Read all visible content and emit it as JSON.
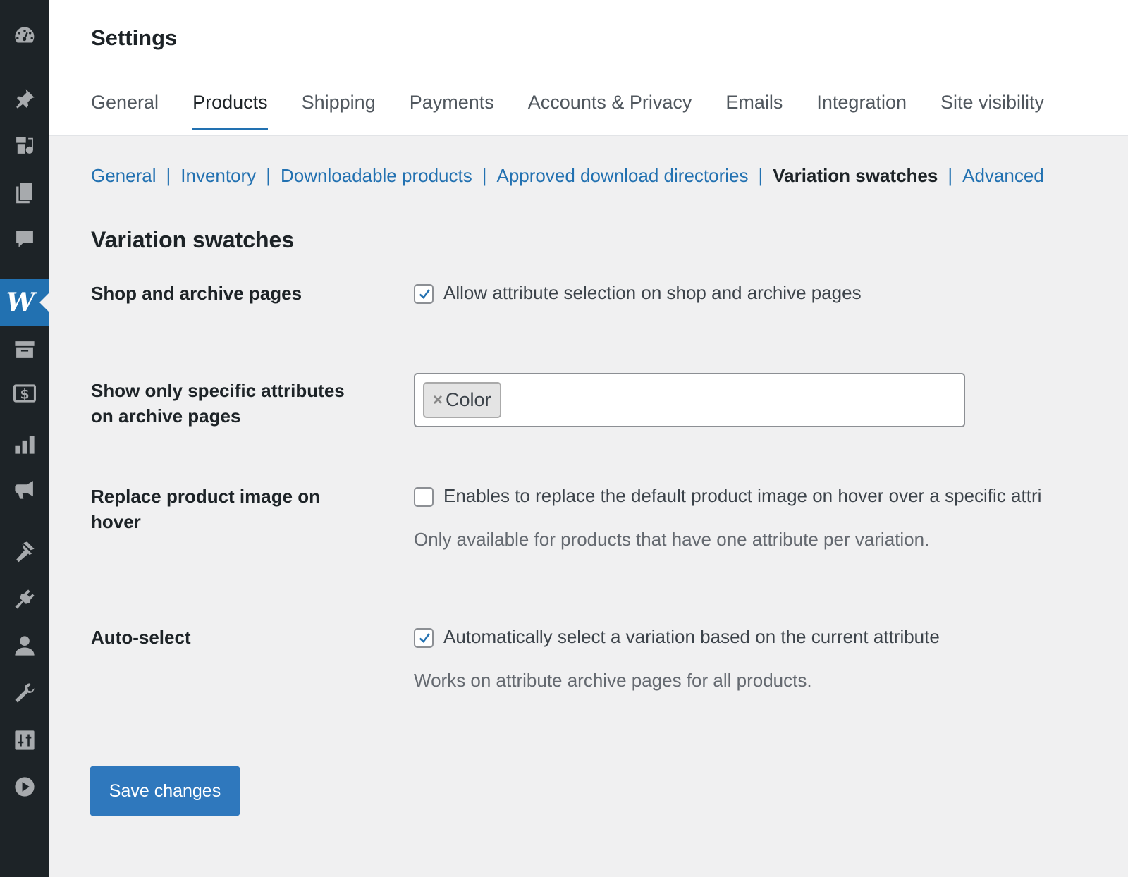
{
  "sidebar": {
    "items": [
      {
        "icon": "dashboard-icon"
      },
      {
        "icon": "pin-icon"
      },
      {
        "icon": "media-icon"
      },
      {
        "icon": "pages-icon"
      },
      {
        "icon": "comments-icon"
      },
      {
        "icon": "woocommerce-icon",
        "label": "W",
        "active": true
      },
      {
        "icon": "archive-icon"
      },
      {
        "icon": "payments-icon"
      },
      {
        "icon": "analytics-icon"
      },
      {
        "icon": "marketing-icon"
      },
      {
        "icon": "appearance-icon"
      },
      {
        "icon": "plugins-icon"
      },
      {
        "icon": "users-icon"
      },
      {
        "icon": "tools-icon"
      },
      {
        "icon": "settings-sliders-icon"
      },
      {
        "icon": "play-icon"
      }
    ]
  },
  "header": {
    "title": "Settings",
    "tabs": [
      {
        "label": "General"
      },
      {
        "label": "Products",
        "active": true
      },
      {
        "label": "Shipping"
      },
      {
        "label": "Payments"
      },
      {
        "label": "Accounts & Privacy"
      },
      {
        "label": "Emails"
      },
      {
        "label": "Integration"
      },
      {
        "label": "Site visibility"
      }
    ]
  },
  "subnav": {
    "items": [
      {
        "label": "General"
      },
      {
        "label": "Inventory"
      },
      {
        "label": "Downloadable products"
      },
      {
        "label": "Approved download directories"
      },
      {
        "label": "Variation swatches",
        "current": true
      },
      {
        "label": "Advanced"
      }
    ],
    "separator": "|"
  },
  "section": {
    "title": "Variation swatches",
    "rows": {
      "shop_archive": {
        "label": "Shop and archive pages",
        "checkbox_label": "Allow attribute selection on shop and archive pages",
        "checked": true
      },
      "specific_attrs": {
        "label_line1": "Show only specific attributes",
        "label_line2": "on archive pages",
        "selected": [
          "Color"
        ],
        "remove_glyph": "×"
      },
      "replace_image": {
        "label_line1": "Replace product image on",
        "label_line2": "hover",
        "checkbox_label": "Enables to replace the default product image on hover over a specific attri",
        "checked": false,
        "description": "Only available for products that have one attribute per variation."
      },
      "auto_select": {
        "label": "Auto-select",
        "checkbox_label": "Automatically select a variation based on the current attribute",
        "checked": true,
        "description": "Works on attribute archive pages for all products."
      }
    }
  },
  "actions": {
    "save_label": "Save changes"
  },
  "colors": {
    "accent": "#2271b1",
    "sidebar_bg": "#1d2327",
    "page_bg": "#f0f0f1"
  }
}
